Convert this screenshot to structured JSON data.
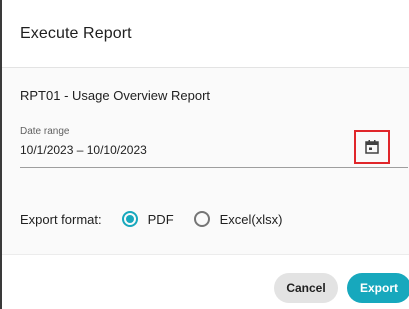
{
  "dialog": {
    "title": "Execute Report",
    "report_name": "RPT01 - Usage Overview Report",
    "date_range": {
      "label": "Date range",
      "value": "10/1/2023 – 10/10/2023",
      "picker_icon": "calendar-icon"
    },
    "export_format": {
      "label": "Export format:",
      "options": [
        {
          "label": "PDF",
          "selected": true
        },
        {
          "label": "Excel(xlsx)",
          "selected": false
        }
      ]
    },
    "buttons": {
      "cancel": "Cancel",
      "export": "Export"
    }
  },
  "colors": {
    "accent": "#17a8bd",
    "highlight_box": "#e0262a",
    "cancel_bg": "#e3e3e3"
  }
}
